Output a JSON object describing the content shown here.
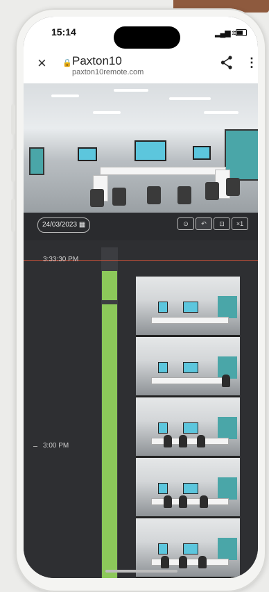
{
  "status_bar": {
    "time": "15:14",
    "signal_icon": "signal-icon",
    "wifi_icon": "wifi-icon",
    "battery_icon": "battery-icon"
  },
  "browser": {
    "close_icon": "×",
    "lock_icon": "🔒",
    "site_title": "Paxton10",
    "url": "paxton10remote.com",
    "share_icon": "share-icon",
    "menu_icon": "more-vert-icon"
  },
  "controls": {
    "date": "24/03/2023",
    "buttons": [
      "⊙",
      "↶",
      "⊡",
      "×1"
    ]
  },
  "timeline": {
    "cursor_time": "3:33:30 PM",
    "tick_label": "3:00 PM",
    "recording_segments": [
      0.16,
      0.84
    ],
    "accent": "#8cc85a",
    "cursor_color": "#c8503a"
  }
}
